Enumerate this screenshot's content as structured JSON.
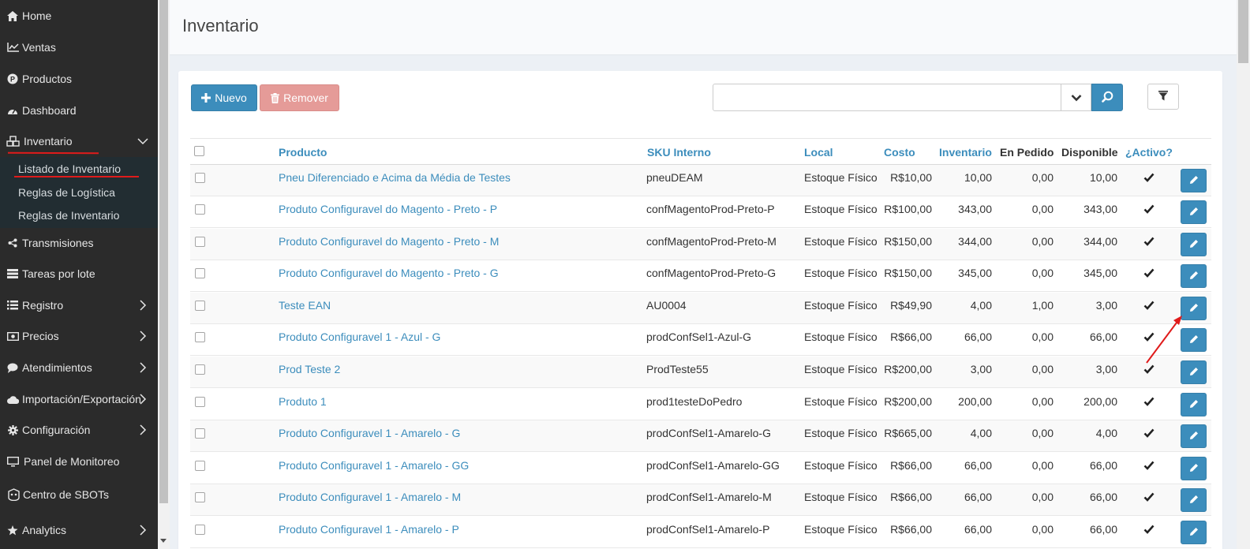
{
  "sidebar": {
    "items": [
      {
        "label": "Home",
        "icon": "home-icon"
      },
      {
        "label": "Ventas",
        "icon": "line-chart-icon"
      },
      {
        "label": "Productos",
        "icon": "product-badge-icon"
      },
      {
        "label": "Dashboard",
        "icon": "dashboard-icon"
      },
      {
        "label": "Inventario",
        "icon": "cubes-icon"
      },
      {
        "label": "Transmisiones",
        "icon": "share-icon"
      },
      {
        "label": "Tareas por lote",
        "icon": "tasks-icon"
      },
      {
        "label": "Registro",
        "icon": "list-icon"
      },
      {
        "label": "Precios",
        "icon": "money-icon"
      },
      {
        "label": "Atendimientos",
        "icon": "comments-icon"
      },
      {
        "label": "Importación/Exportación",
        "icon": "cloud-icon"
      },
      {
        "label": "Configuración",
        "icon": "gear-icon"
      },
      {
        "label": "Panel de Monitoreo",
        "icon": "monitor-icon"
      },
      {
        "label": "Centro de SBOTs",
        "icon": "robot-icon"
      },
      {
        "label": "Analytics",
        "icon": "star-icon"
      }
    ],
    "submenu": [
      "Listado de Inventario",
      "Reglas de Logística",
      "Reglas de Inventario"
    ]
  },
  "header": {
    "title": "Inventario"
  },
  "toolbar": {
    "new_label": "Nuevo",
    "remove_label": "Remover",
    "search_value": ""
  },
  "table": {
    "headers": {
      "producto": "Producto",
      "sku": "SKU Interno",
      "local": "Local",
      "costo": "Costo",
      "inventario": "Inventario",
      "pedido": "En Pedido",
      "disponible": "Disponible",
      "activo": "¿Activo?"
    },
    "rows": [
      {
        "producto": "Pneu Diferenciado e Acima da Média de Testes",
        "sku": "pneuDEAM",
        "local": "Estoque Físico",
        "costo": "R$10,00",
        "inventario": "10,00",
        "pedido": "0,00",
        "disponible": "10,00",
        "activo": true
      },
      {
        "producto": "Produto Configuravel do Magento - Preto - P",
        "sku": "confMagentoProd-Preto-P",
        "local": "Estoque Físico",
        "costo": "R$100,00",
        "inventario": "343,00",
        "pedido": "0,00",
        "disponible": "343,00",
        "activo": true
      },
      {
        "producto": "Produto Configuravel do Magento - Preto - M",
        "sku": "confMagentoProd-Preto-M",
        "local": "Estoque Físico",
        "costo": "R$150,00",
        "inventario": "344,00",
        "pedido": "0,00",
        "disponible": "344,00",
        "activo": true
      },
      {
        "producto": "Produto Configuravel do Magento - Preto - G",
        "sku": "confMagentoProd-Preto-G",
        "local": "Estoque Físico",
        "costo": "R$150,00",
        "inventario": "345,00",
        "pedido": "0,00",
        "disponible": "345,00",
        "activo": true
      },
      {
        "producto": "Teste EAN",
        "sku": "AU0004",
        "local": "Estoque Físico",
        "costo": "R$49,90",
        "inventario": "4,00",
        "pedido": "1,00",
        "disponible": "3,00",
        "activo": true
      },
      {
        "producto": "Produto Configuravel 1 - Azul - G",
        "sku": "prodConfSel1-Azul-G",
        "local": "Estoque Físico",
        "costo": "R$66,00",
        "inventario": "66,00",
        "pedido": "0,00",
        "disponible": "66,00",
        "activo": true
      },
      {
        "producto": "Prod Teste 2",
        "sku": "ProdTeste55",
        "local": "Estoque Físico",
        "costo": "R$200,00",
        "inventario": "3,00",
        "pedido": "0,00",
        "disponible": "3,00",
        "activo": true
      },
      {
        "producto": "Produto 1",
        "sku": "prod1testeDoPedro",
        "local": "Estoque Físico",
        "costo": "R$200,00",
        "inventario": "200,00",
        "pedido": "0,00",
        "disponible": "200,00",
        "activo": true
      },
      {
        "producto": "Produto Configuravel 1 - Amarelo - G",
        "sku": "prodConfSel1-Amarelo-G",
        "local": "Estoque Físico",
        "costo": "R$665,00",
        "inventario": "4,00",
        "pedido": "0,00",
        "disponible": "4,00",
        "activo": true
      },
      {
        "producto": "Produto Configuravel 1 - Amarelo - GG",
        "sku": "prodConfSel1-Amarelo-GG",
        "local": "Estoque Físico",
        "costo": "R$66,00",
        "inventario": "66,00",
        "pedido": "0,00",
        "disponible": "66,00",
        "activo": true
      },
      {
        "producto": "Produto Configuravel 1 - Amarelo - M",
        "sku": "prodConfSel1-Amarelo-M",
        "local": "Estoque Físico",
        "costo": "R$66,00",
        "inventario": "66,00",
        "pedido": "0,00",
        "disponible": "66,00",
        "activo": true
      },
      {
        "producto": "Produto Configuravel 1 - Amarelo - P",
        "sku": "prodConfSel1-Amarelo-P",
        "local": "Estoque Físico",
        "costo": "R$66,00",
        "inventario": "66,00",
        "pedido": "0,00",
        "disponible": "66,00",
        "activo": true
      }
    ]
  },
  "colors": {
    "sidebar_bg": "#2b2b2b",
    "submenu_bg": "#222d32",
    "primary": "#3c8dbc",
    "danger_light": "#e59b98",
    "annotation_red": "#e01b1b"
  }
}
